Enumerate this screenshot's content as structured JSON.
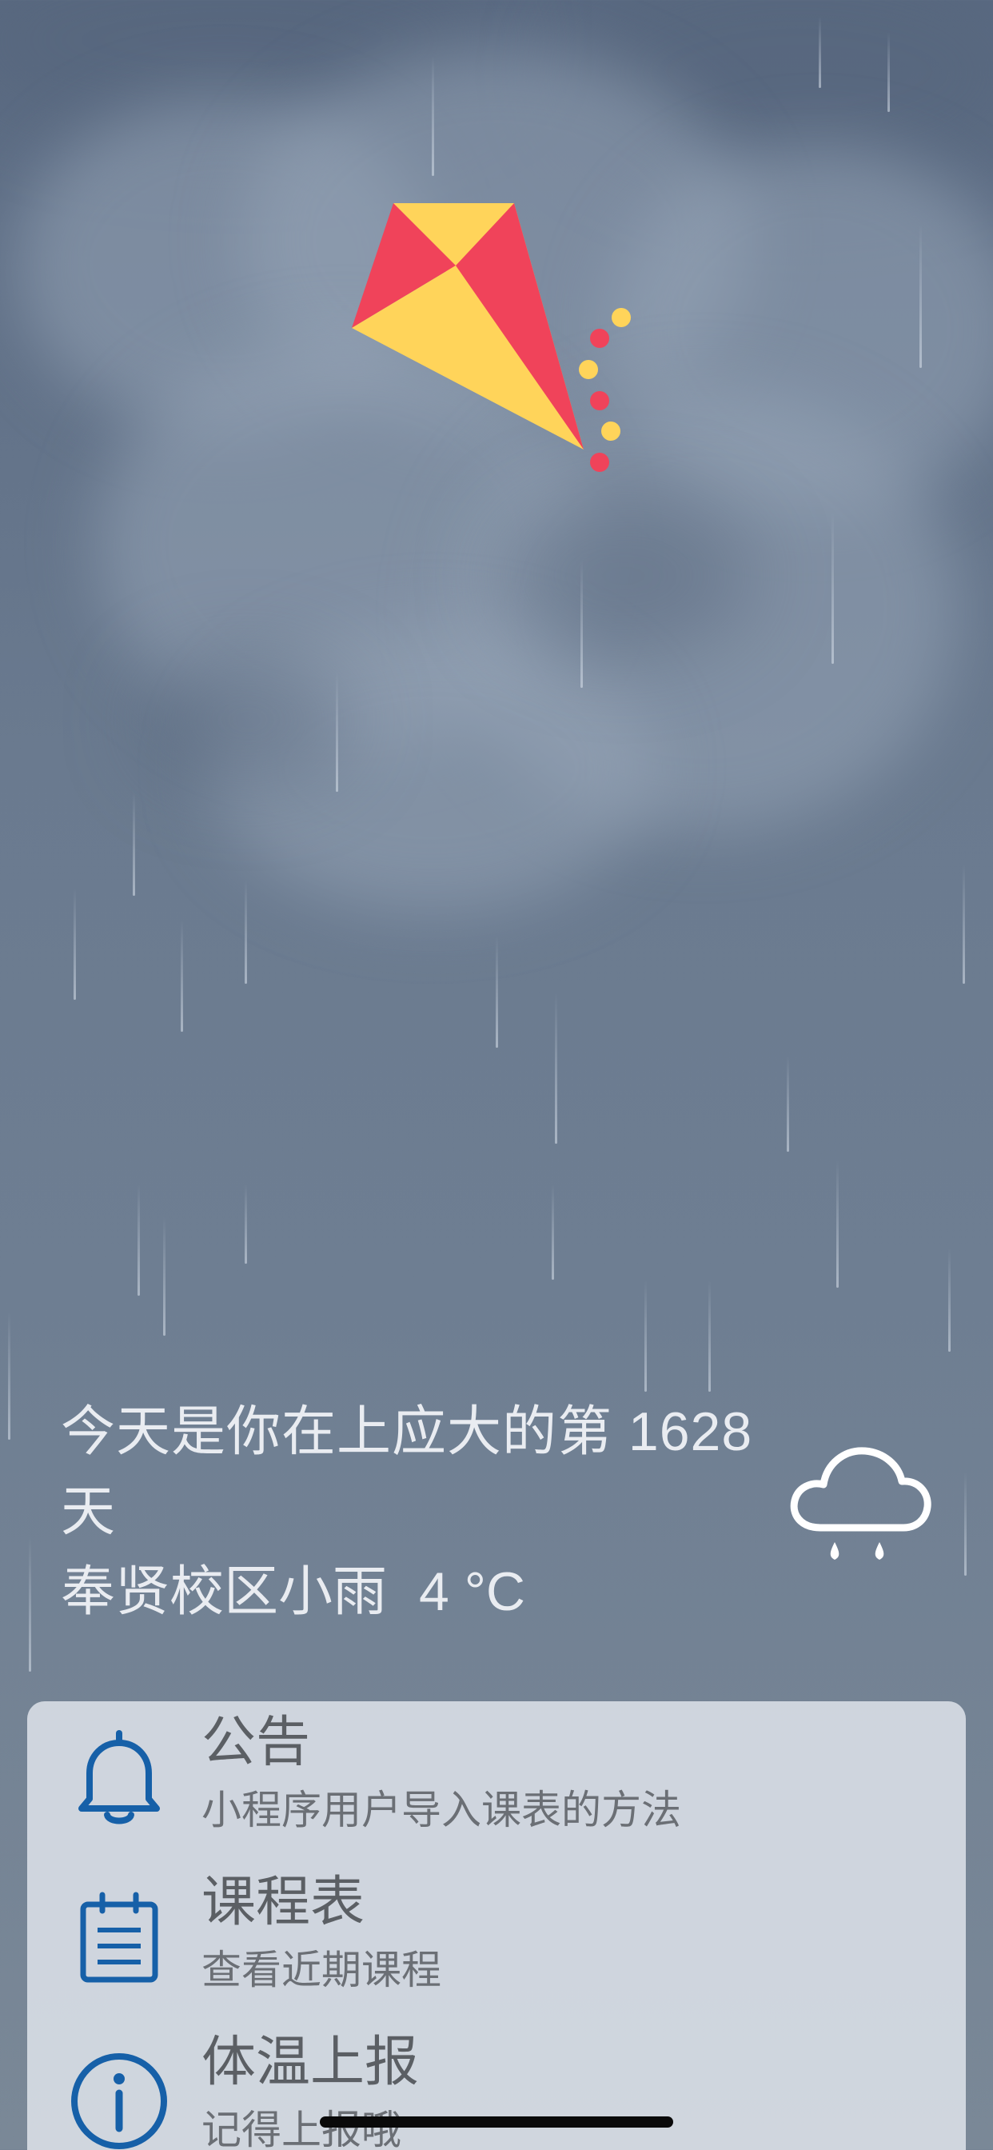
{
  "greeting": {
    "prefix": "今天是你在上应大的第",
    "days": "1628",
    "suffix": "天"
  },
  "weather": {
    "campus_condition": "奉贤校区小雨",
    "temperature": "4 °C",
    "icon": "cloud-rain-icon"
  },
  "menu": [
    {
      "title": "公告",
      "subtitle": "小程序用户导入课表的方法",
      "icon": "bell-icon"
    },
    {
      "title": "课程表",
      "subtitle": "查看近期课程",
      "icon": "calendar-icon"
    },
    {
      "title": "体温上报",
      "subtitle": "记得上报哦",
      "icon": "info-icon"
    }
  ],
  "colors": {
    "accent_blue": "#1660a8",
    "kite_red": "#f0435a",
    "kite_yellow": "#ffd45a",
    "card_bg": "#d6dce3"
  }
}
